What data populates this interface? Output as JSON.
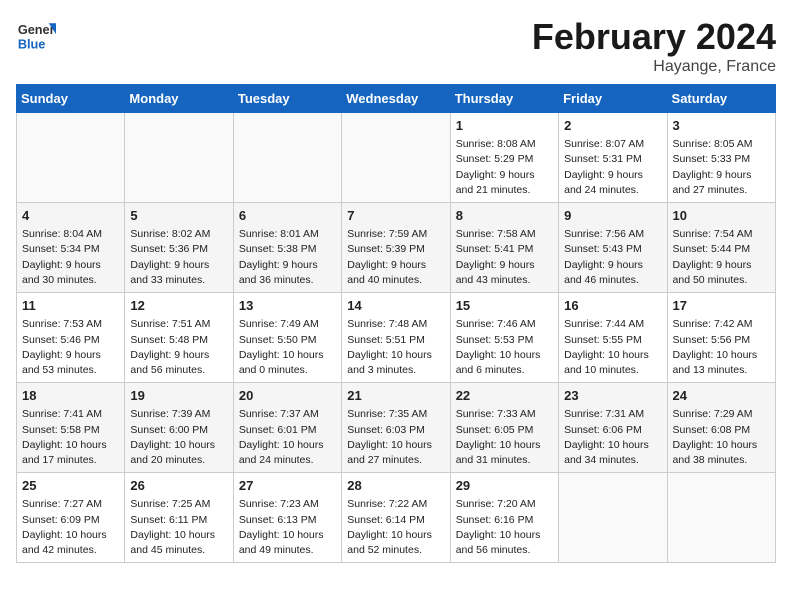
{
  "header": {
    "logo_general": "General",
    "logo_blue": "Blue",
    "month_title": "February 2024",
    "location": "Hayange, France"
  },
  "weekdays": [
    "Sunday",
    "Monday",
    "Tuesday",
    "Wednesday",
    "Thursday",
    "Friday",
    "Saturday"
  ],
  "weeks": [
    [
      {
        "day": "",
        "info": ""
      },
      {
        "day": "",
        "info": ""
      },
      {
        "day": "",
        "info": ""
      },
      {
        "day": "",
        "info": ""
      },
      {
        "day": "1",
        "info": "Sunrise: 8:08 AM\nSunset: 5:29 PM\nDaylight: 9 hours\nand 21 minutes."
      },
      {
        "day": "2",
        "info": "Sunrise: 8:07 AM\nSunset: 5:31 PM\nDaylight: 9 hours\nand 24 minutes."
      },
      {
        "day": "3",
        "info": "Sunrise: 8:05 AM\nSunset: 5:33 PM\nDaylight: 9 hours\nand 27 minutes."
      }
    ],
    [
      {
        "day": "4",
        "info": "Sunrise: 8:04 AM\nSunset: 5:34 PM\nDaylight: 9 hours\nand 30 minutes."
      },
      {
        "day": "5",
        "info": "Sunrise: 8:02 AM\nSunset: 5:36 PM\nDaylight: 9 hours\nand 33 minutes."
      },
      {
        "day": "6",
        "info": "Sunrise: 8:01 AM\nSunset: 5:38 PM\nDaylight: 9 hours\nand 36 minutes."
      },
      {
        "day": "7",
        "info": "Sunrise: 7:59 AM\nSunset: 5:39 PM\nDaylight: 9 hours\nand 40 minutes."
      },
      {
        "day": "8",
        "info": "Sunrise: 7:58 AM\nSunset: 5:41 PM\nDaylight: 9 hours\nand 43 minutes."
      },
      {
        "day": "9",
        "info": "Sunrise: 7:56 AM\nSunset: 5:43 PM\nDaylight: 9 hours\nand 46 minutes."
      },
      {
        "day": "10",
        "info": "Sunrise: 7:54 AM\nSunset: 5:44 PM\nDaylight: 9 hours\nand 50 minutes."
      }
    ],
    [
      {
        "day": "11",
        "info": "Sunrise: 7:53 AM\nSunset: 5:46 PM\nDaylight: 9 hours\nand 53 minutes."
      },
      {
        "day": "12",
        "info": "Sunrise: 7:51 AM\nSunset: 5:48 PM\nDaylight: 9 hours\nand 56 minutes."
      },
      {
        "day": "13",
        "info": "Sunrise: 7:49 AM\nSunset: 5:50 PM\nDaylight: 10 hours\nand 0 minutes."
      },
      {
        "day": "14",
        "info": "Sunrise: 7:48 AM\nSunset: 5:51 PM\nDaylight: 10 hours\nand 3 minutes."
      },
      {
        "day": "15",
        "info": "Sunrise: 7:46 AM\nSunset: 5:53 PM\nDaylight: 10 hours\nand 6 minutes."
      },
      {
        "day": "16",
        "info": "Sunrise: 7:44 AM\nSunset: 5:55 PM\nDaylight: 10 hours\nand 10 minutes."
      },
      {
        "day": "17",
        "info": "Sunrise: 7:42 AM\nSunset: 5:56 PM\nDaylight: 10 hours\nand 13 minutes."
      }
    ],
    [
      {
        "day": "18",
        "info": "Sunrise: 7:41 AM\nSunset: 5:58 PM\nDaylight: 10 hours\nand 17 minutes."
      },
      {
        "day": "19",
        "info": "Sunrise: 7:39 AM\nSunset: 6:00 PM\nDaylight: 10 hours\nand 20 minutes."
      },
      {
        "day": "20",
        "info": "Sunrise: 7:37 AM\nSunset: 6:01 PM\nDaylight: 10 hours\nand 24 minutes."
      },
      {
        "day": "21",
        "info": "Sunrise: 7:35 AM\nSunset: 6:03 PM\nDaylight: 10 hours\nand 27 minutes."
      },
      {
        "day": "22",
        "info": "Sunrise: 7:33 AM\nSunset: 6:05 PM\nDaylight: 10 hours\nand 31 minutes."
      },
      {
        "day": "23",
        "info": "Sunrise: 7:31 AM\nSunset: 6:06 PM\nDaylight: 10 hours\nand 34 minutes."
      },
      {
        "day": "24",
        "info": "Sunrise: 7:29 AM\nSunset: 6:08 PM\nDaylight: 10 hours\nand 38 minutes."
      }
    ],
    [
      {
        "day": "25",
        "info": "Sunrise: 7:27 AM\nSunset: 6:09 PM\nDaylight: 10 hours\nand 42 minutes."
      },
      {
        "day": "26",
        "info": "Sunrise: 7:25 AM\nSunset: 6:11 PM\nDaylight: 10 hours\nand 45 minutes."
      },
      {
        "day": "27",
        "info": "Sunrise: 7:23 AM\nSunset: 6:13 PM\nDaylight: 10 hours\nand 49 minutes."
      },
      {
        "day": "28",
        "info": "Sunrise: 7:22 AM\nSunset: 6:14 PM\nDaylight: 10 hours\nand 52 minutes."
      },
      {
        "day": "29",
        "info": "Sunrise: 7:20 AM\nSunset: 6:16 PM\nDaylight: 10 hours\nand 56 minutes."
      },
      {
        "day": "",
        "info": ""
      },
      {
        "day": "",
        "info": ""
      }
    ]
  ]
}
